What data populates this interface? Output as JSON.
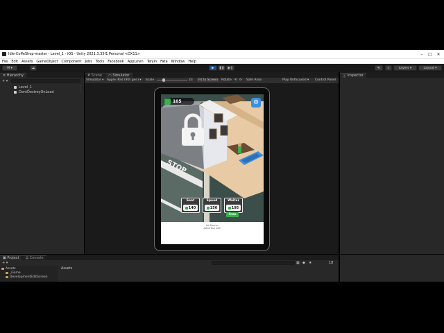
{
  "window": {
    "title": "Idle-CoffeShop-master - Level_1 - iOS - Unity 2021.3.35f1 Personal <DX11>",
    "controls": [
      "–",
      "□",
      "✕"
    ]
  },
  "menu": [
    "File",
    "Edit",
    "Assets",
    "GameObject",
    "Component",
    "Jobs",
    "Tools",
    "Facebook",
    "AppLovin",
    "Tenjin",
    "Fata",
    "Window",
    "Help"
  ],
  "toolbar": {
    "account": "M ▾",
    "cloud_icon": "cloud-icon",
    "layers": "Layers",
    "layout": "Layout"
  },
  "hierarchy": {
    "tab": "Hierarchy",
    "add": "+ ▾",
    "items": [
      "Level_1",
      "DontDestroyOnLoad"
    ]
  },
  "center": {
    "tabs": [
      "Scene",
      "Simulator"
    ],
    "simulator_toolbar": {
      "mode": "Simulator ▾",
      "device": "Apple iPad (9th gen) ▾",
      "scale_label": "Scale",
      "scale_value": "23",
      "fit": "Fit to Screen",
      "rotate": "Rotate",
      "safe_area": "Safe Area",
      "play_focus": "Play Unfocused ▾",
      "control": "Control Panel"
    }
  },
  "inspector": {
    "tab": "Inspector"
  },
  "bottom": {
    "tabs": [
      "Project",
      "Console"
    ],
    "badge": "18",
    "tree": [
      "Assets",
      "_Game",
      "DevelopmentEditScreen"
    ],
    "content_breadcrumb": "Assets"
  },
  "game": {
    "cash": "105",
    "sign_text": "STOP",
    "upgrades": [
      {
        "title": "Seat",
        "price": "140"
      },
      {
        "title": "Speed",
        "price": "150"
      },
      {
        "title": "Waiter",
        "price": "195"
      }
    ],
    "free_label": "Free",
    "ad_lines": [
      "Ad Banner",
      "Advertise with"
    ],
    "colors": {
      "cash_green": "#3bb04e",
      "gear_blue": "#3d8fe0",
      "play_blue": "#1e4f86"
    }
  }
}
